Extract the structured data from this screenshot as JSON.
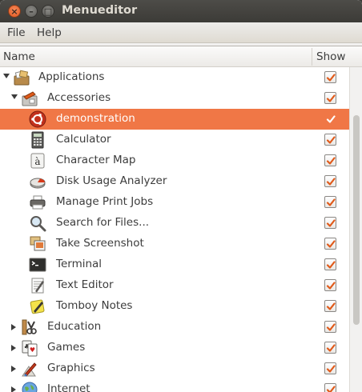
{
  "window": {
    "title": "Menueditor"
  },
  "menu": {
    "file": "File",
    "help": "Help"
  },
  "columns": {
    "name": "Name",
    "show": "Show"
  },
  "rows": [
    {
      "label": "Applications",
      "icon": "applications-icon",
      "checked": true,
      "level": 0,
      "expander": "down"
    },
    {
      "label": "Accessories",
      "icon": "accessories-icon",
      "checked": true,
      "level": 1,
      "expander": "down"
    },
    {
      "label": "demonstration",
      "icon": "ubuntu-icon",
      "checked": true,
      "level": 2,
      "selected": true
    },
    {
      "label": "Calculator",
      "icon": "calculator-icon",
      "checked": true,
      "level": 2
    },
    {
      "label": "Character Map",
      "icon": "character-map-icon",
      "checked": true,
      "level": 2
    },
    {
      "label": "Disk Usage Analyzer",
      "icon": "disk-usage-icon",
      "checked": true,
      "level": 2
    },
    {
      "label": "Manage Print Jobs",
      "icon": "printer-icon",
      "checked": true,
      "level": 2
    },
    {
      "label": "Search for Files...",
      "icon": "search-icon",
      "checked": true,
      "level": 2
    },
    {
      "label": "Take Screenshot",
      "icon": "screenshot-icon",
      "checked": true,
      "level": 2
    },
    {
      "label": "Terminal",
      "icon": "terminal-icon",
      "checked": true,
      "level": 2
    },
    {
      "label": "Text Editor",
      "icon": "text-editor-icon",
      "checked": true,
      "level": 2
    },
    {
      "label": "Tomboy Notes",
      "icon": "tomboy-icon",
      "checked": true,
      "level": 2
    },
    {
      "label": "Education",
      "icon": "education-icon",
      "checked": true,
      "level": 1,
      "expander": "right"
    },
    {
      "label": "Games",
      "icon": "games-icon",
      "checked": true,
      "level": 1,
      "expander": "right"
    },
    {
      "label": "Graphics",
      "icon": "graphics-icon",
      "checked": true,
      "level": 1,
      "expander": "right"
    },
    {
      "label": "Internet",
      "icon": "internet-icon",
      "checked": true,
      "level": 1,
      "expander": "right"
    }
  ],
  "colors": {
    "accent": "#f07746",
    "check": "#e05a1a"
  }
}
